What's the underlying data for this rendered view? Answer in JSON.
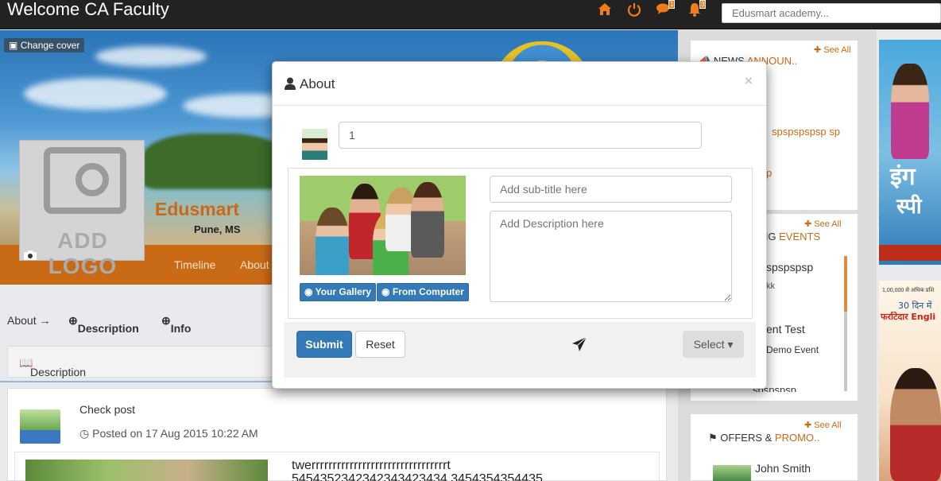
{
  "navbar": {
    "title": "Welcome CA Faculty",
    "messages_count": "1",
    "notifications_count": "3",
    "search_placeholder": "Edusmart academy..."
  },
  "cover": {
    "change_cover_label": "Change cover",
    "logo_placeholder": "ADD LOGO",
    "school_name": "Edusmart",
    "school_city": "Pune, MS",
    "tabs": [
      "Timeline",
      "About"
    ]
  },
  "about_strip": {
    "about": "About →",
    "description": "Description",
    "info": "Info"
  },
  "description_panel": {
    "title": "Description"
  },
  "post": {
    "title": "Check post",
    "date": "Posted on 17 Aug 2015 10:22 AM",
    "text_line1": "twerrrrrrrrrrrrrrrrrrrrrrrrrrrrrrrrt",
    "text_line2": "5454352342342343423434 3454354354435"
  },
  "sidebar": {
    "see_all": "See All",
    "news_head_a": "NEWS ",
    "news_head_b": "ANNOUN..",
    "news_item": "spspspspsp sp",
    "news_item2": "p",
    "events_head_a": "NG ",
    "events_head_b": "EVENTS",
    "event1": "spspspsp",
    "event1_sub": "kk",
    "event2": "ent Test",
    "event2_sub": "Demo Event",
    "event3": "spspspsp",
    "offers_head_a": "OFFERS & ",
    "offers_head_b": "PROMO..",
    "offer1": "John Smith"
  },
  "ads": {
    "ad1_text": "इंग",
    "ad1_text2": "स्पी",
    "ad2_line1": "1,00,000 से अधिक प्रशि",
    "ad2_line2": "30 दिन में",
    "ad2_line3": "फर्राटेदार Engli"
  },
  "modal": {
    "title": "About",
    "close": "×",
    "title_value": "1",
    "gallery_button": "Your Gallery",
    "computer_button": "From Computer",
    "subtitle_placeholder": "Add sub-title here",
    "description_placeholder": "Add Description here",
    "submit": "Submit",
    "reset": "Reset",
    "select": "Select ▾"
  },
  "colors": {
    "accent": "#f07b1a",
    "primary_button": "#337ab7",
    "orange_bar": "#c96a16"
  }
}
